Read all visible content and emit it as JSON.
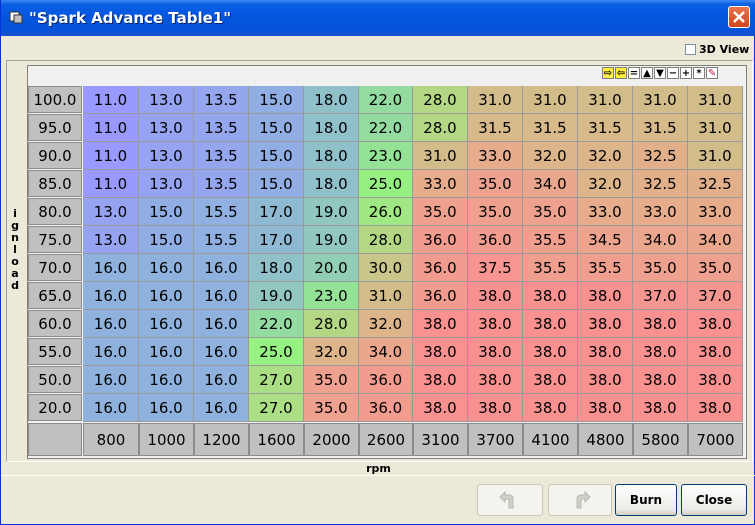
{
  "window": {
    "title": "\"Spark Advance Table1\"",
    "icons": [
      "app-icon",
      "close-icon"
    ]
  },
  "view3d": {
    "label": "3D View",
    "checked": false
  },
  "toolbar": {
    "buttons": [
      "⇨",
      "⇦",
      "=",
      "▲",
      "▼",
      "−",
      "+",
      "*",
      "✎"
    ]
  },
  "axes": {
    "y_label": "ignload",
    "x_label": "rpm"
  },
  "table": {
    "row_headers": [
      "100.0",
      "95.0",
      "90.0",
      "85.0",
      "80.0",
      "75.0",
      "70.0",
      "65.0",
      "60.0",
      "55.0",
      "50.0",
      "20.0"
    ],
    "col_headers": [
      "800",
      "1000",
      "1200",
      "1600",
      "2000",
      "2600",
      "3100",
      "3700",
      "4100",
      "4800",
      "5800",
      "7000"
    ],
    "rows": [
      [
        "11.0",
        "13.0",
        "13.5",
        "15.0",
        "18.0",
        "22.0",
        "28.0",
        "31.0",
        "31.0",
        "31.0",
        "31.0",
        "31.0"
      ],
      [
        "11.0",
        "13.0",
        "13.5",
        "15.0",
        "18.0",
        "22.0",
        "28.0",
        "31.5",
        "31.5",
        "31.5",
        "31.5",
        "31.0"
      ],
      [
        "11.0",
        "13.0",
        "13.5",
        "15.0",
        "18.0",
        "23.0",
        "31.0",
        "33.0",
        "32.0",
        "32.0",
        "32.5",
        "31.0"
      ],
      [
        "11.0",
        "13.0",
        "13.5",
        "15.0",
        "18.0",
        "25.0",
        "33.0",
        "35.0",
        "34.0",
        "32.0",
        "32.5",
        "32.5"
      ],
      [
        "13.0",
        "15.0",
        "15.5",
        "17.0",
        "19.0",
        "26.0",
        "35.0",
        "35.0",
        "35.0",
        "33.0",
        "33.0",
        "33.0"
      ],
      [
        "13.0",
        "15.0",
        "15.5",
        "17.0",
        "19.0",
        "28.0",
        "36.0",
        "36.0",
        "35.5",
        "34.5",
        "34.0",
        "34.0"
      ],
      [
        "16.0",
        "16.0",
        "16.0",
        "18.0",
        "20.0",
        "30.0",
        "36.0",
        "37.5",
        "35.5",
        "35.5",
        "35.0",
        "35.0"
      ],
      [
        "16.0",
        "16.0",
        "16.0",
        "19.0",
        "23.0",
        "31.0",
        "36.0",
        "38.0",
        "38.0",
        "38.0",
        "37.0",
        "37.0"
      ],
      [
        "16.0",
        "16.0",
        "16.0",
        "22.0",
        "28.0",
        "32.0",
        "38.0",
        "38.0",
        "38.0",
        "38.0",
        "38.0",
        "38.0"
      ],
      [
        "16.0",
        "16.0",
        "16.0",
        "25.0",
        "32.0",
        "34.0",
        "38.0",
        "38.0",
        "38.0",
        "38.0",
        "38.0",
        "38.0"
      ],
      [
        "16.0",
        "16.0",
        "16.0",
        "27.0",
        "35.0",
        "36.0",
        "38.0",
        "38.0",
        "38.0",
        "38.0",
        "38.0",
        "38.0"
      ],
      [
        "16.0",
        "16.0",
        "16.0",
        "27.0",
        "35.0",
        "36.0",
        "38.0",
        "38.0",
        "38.0",
        "38.0",
        "38.0",
        "38.0"
      ]
    ]
  },
  "buttons": {
    "undo_icon": "undo-icon",
    "redo_icon": "redo-icon",
    "burn": "Burn",
    "close": "Close"
  }
}
